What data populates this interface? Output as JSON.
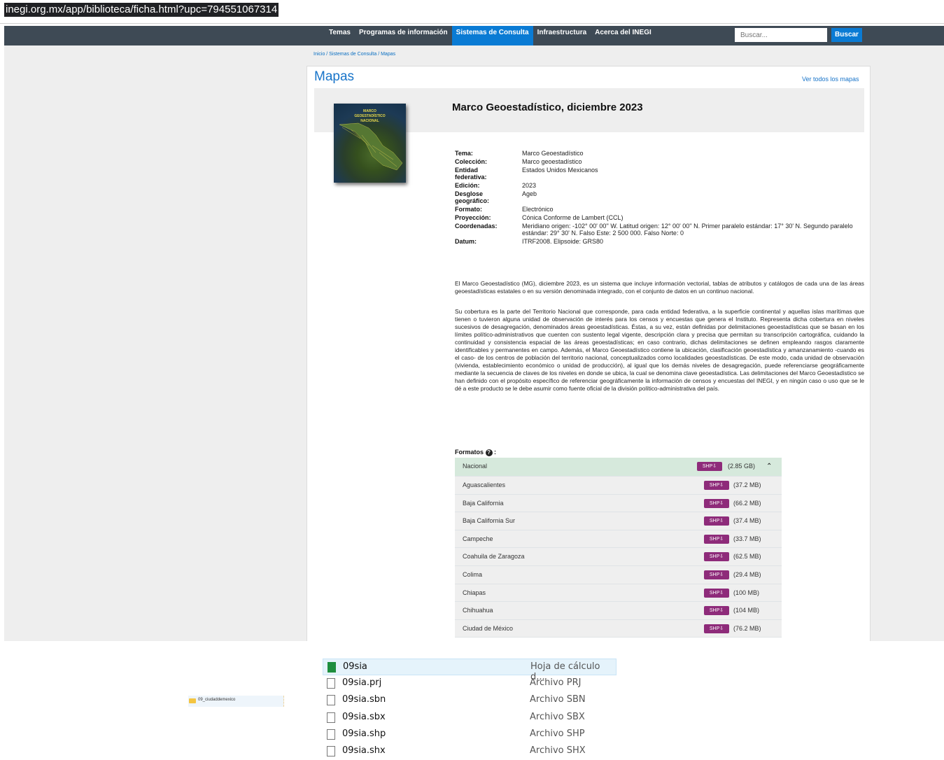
{
  "browser": {
    "url": "inegi.org.mx/app/biblioteca/ficha.html?upc=794551067314"
  },
  "nav": {
    "items": [
      {
        "label": "Temas",
        "active": false
      },
      {
        "label": "Programas de información",
        "active": false
      },
      {
        "label": "Sistemas de Consulta",
        "active": true
      },
      {
        "label": "Infraestructura",
        "active": false
      },
      {
        "label": "Acerca del INEGI",
        "active": false
      }
    ],
    "search_placeholder": "Buscar...",
    "search_button": "Buscar"
  },
  "breadcrumb": "Inicio / Sistemas de Consulta / Mapas",
  "page_title": "Mapas",
  "see_all": "Ver todos los mapas",
  "record": {
    "title": "Marco Geoestadístico, diciembre 2023",
    "cover_text": [
      "MARCO",
      "GEOESTADÍSTICO",
      "NACIONAL"
    ],
    "metadata": [
      {
        "label": "Tema:",
        "value": "Marco Geoestadístico"
      },
      {
        "label": "Colección:",
        "value": "Marco geoestadístico"
      },
      {
        "label": "Entidad federativa:",
        "value": "Estados Unidos Mexicanos"
      },
      {
        "label": "Edición:",
        "value": "2023"
      },
      {
        "label": "Desglose geográfico:",
        "value": "Ageb"
      },
      {
        "label": "Formato:",
        "value": "Electrónico"
      },
      {
        "label": "Proyección:",
        "value": "Cónica Conforme de Lambert (CCL)"
      },
      {
        "label": "Coordenadas:",
        "value": "Meridiano origen: -102° 00' 00'' W. Latitud origen: 12° 00' 00'' N. Primer paralelo estándar: 17° 30' N. Segundo paralelo estándar: 29° 30' N. Falso Este: 2 500 000. Falso Norte: 0"
      },
      {
        "label": "Datum:",
        "value": "ITRF2008. Elipsoide: GRS80"
      }
    ],
    "description_1": "El Marco Geoestadístico (MG), diciembre 2023, es un sistema que incluye información vectorial, tablas de atributos y catálogos de cada una de las áreas geoestadísticas estatales o en su versión denominada integrado, con el conjunto de datos en un continuo nacional.",
    "description_2": "Su cobertura es la parte del Territorio Nacional que corresponde, para cada entidad federativa, a la superficie continental y aquellas islas marítimas que tienen o tuvieron alguna unidad de observación de interés para los censos y encuestas que genera el Instituto. Representa dicha cobertura en niveles sucesivos de desagregación, denominados áreas geoestadísticas. Éstas, a su vez, están definidas por delimitaciones geoestadísticas que se basan en los límites político-administrativos que cuenten con sustento legal vigente, descripción clara y precisa que permitan su transcripción cartográfica, cuidando la continuidad y consistencia espacial de las áreas geoestadísticas; en caso contrario, dichas delimitaciones se definen empleando rasgos claramente identificables y permanentes en campo. Además, el Marco Geoestadístico contiene la ubicación, clasificación geoestadística y amanzanamiento -cuando es el caso- de los centros de población del territorio nacional, conceptualizados como localidades geoestadísticas. De este modo, cada unidad de observación (vivienda, establecimiento económico o unidad de producción), al igual que los demás niveles de desagregación, puede referenciarse geográficamente mediante la secuencia de claves de los niveles en donde se ubica, la cual se denomina clave geoestadística. Las delimitaciones del Marco Geoestadístico se han definido con el propósito específico de referenciar geográficamente la información de censos y encuestas del INEGI, y en ningún caso o uso que se le dé a este producto se le debe asumir como fuente oficial de la división político-administrativa del país."
  },
  "formats": {
    "label": "Formatos",
    "help_icon": "question-circle-icon",
    "button_label": "SHP⇩",
    "national": {
      "name": "Nacional",
      "size": "(2.85 GB)",
      "caret": "⌃"
    },
    "states": [
      {
        "name": "Aguascalientes",
        "size": "(37.2 MB)"
      },
      {
        "name": "Baja California",
        "size": "(66.2 MB)"
      },
      {
        "name": "Baja California Sur",
        "size": "(37.4 MB)"
      },
      {
        "name": "Campeche",
        "size": "(33.7 MB)"
      },
      {
        "name": "Coahuila de Zaragoza",
        "size": "(62.5 MB)"
      },
      {
        "name": "Colima",
        "size": "(29.4 MB)"
      },
      {
        "name": "Chiapas",
        "size": "(100 MB)"
      },
      {
        "name": "Chihuahua",
        "size": "(104 MB)"
      },
      {
        "name": "Ciudad de México",
        "size": "(76.2 MB)"
      }
    ]
  },
  "explorer": {
    "folder": "09_ciudaddemexico",
    "files": [
      {
        "name": "09sia",
        "type": "Hoja de cálculo d...",
        "icon": "spreadsheet-icon",
        "selected": true
      },
      {
        "name": "09sia.prj",
        "type": "Archivo PRJ",
        "icon": "file-icon",
        "selected": false
      },
      {
        "name": "09sia.sbn",
        "type": "Archivo SBN",
        "icon": "file-icon",
        "selected": false
      },
      {
        "name": "09sia.sbx",
        "type": "Archivo SBX",
        "icon": "file-icon",
        "selected": false
      },
      {
        "name": "09sia.shp",
        "type": "Archivo SHP",
        "icon": "file-icon",
        "selected": false
      },
      {
        "name": "09sia.shx",
        "type": "Archivo SHX",
        "icon": "file-icon",
        "selected": false
      }
    ]
  },
  "colors": {
    "nav_bg": "#3e4a55",
    "accent": "#0a7bd4",
    "shp_button": "#8e2b7a",
    "national_row": "#d6e9dc"
  }
}
